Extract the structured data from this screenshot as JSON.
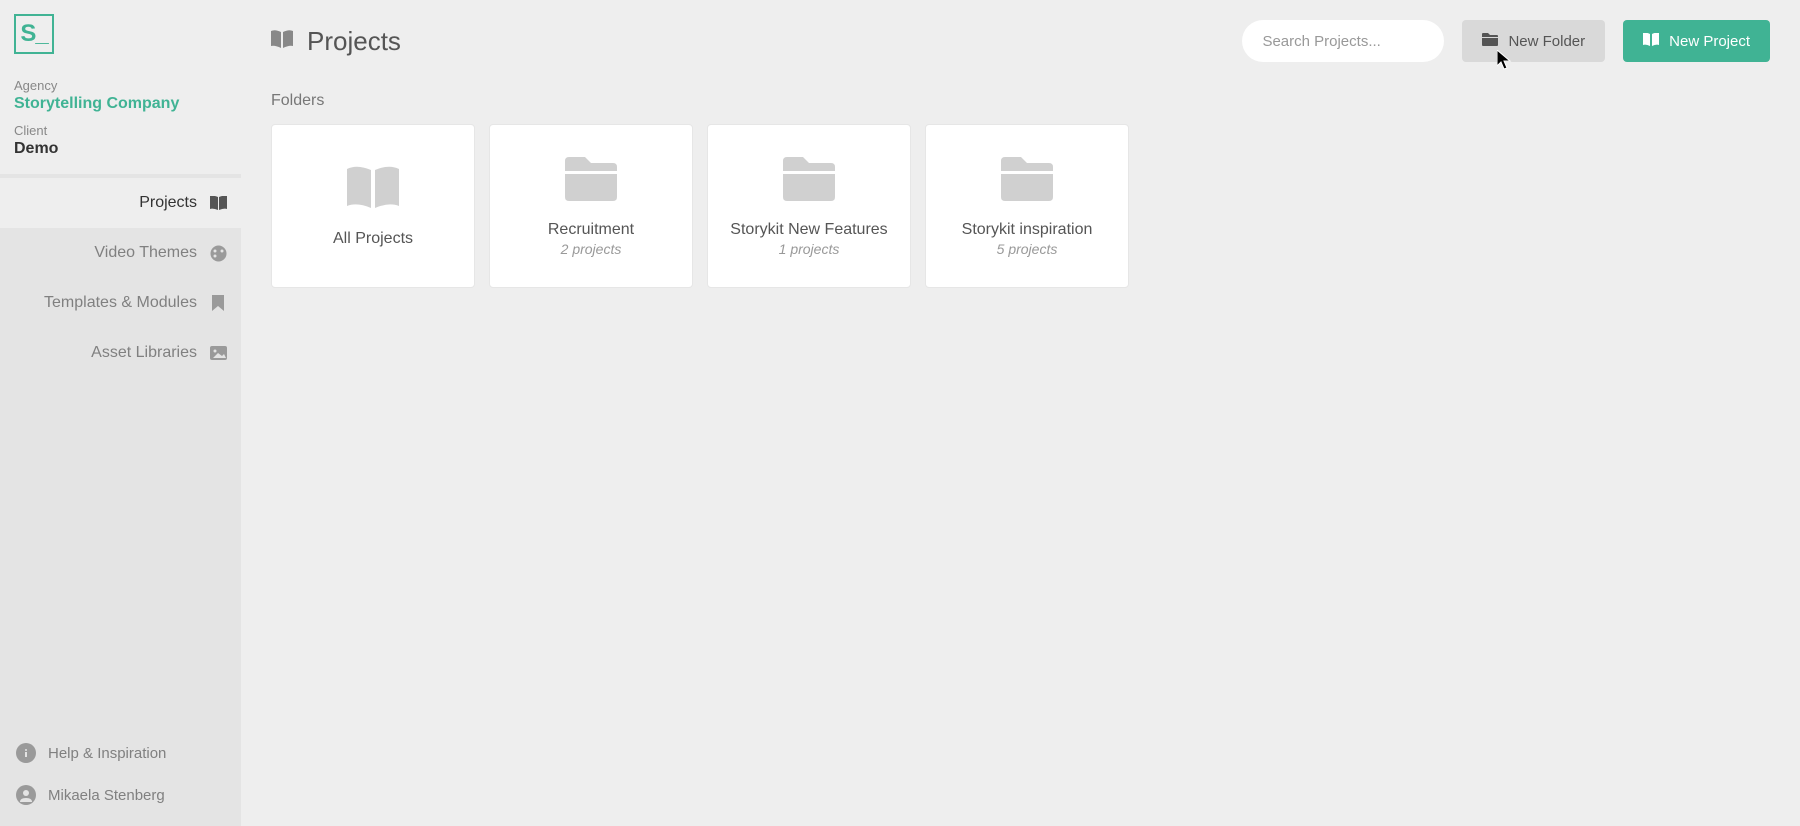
{
  "logo_text": "S_",
  "sidebar": {
    "agency_label": "Agency",
    "agency_name": "Storytelling Company",
    "client_label": "Client",
    "client_name": "Demo",
    "nav": [
      {
        "label": "Projects"
      },
      {
        "label": "Video Themes"
      },
      {
        "label": "Templates & Modules"
      },
      {
        "label": "Asset Libraries"
      }
    ],
    "footer": {
      "help": "Help & Inspiration",
      "user": "Mikaela Stenberg"
    }
  },
  "header": {
    "title": "Projects",
    "search_placeholder": "Search Projects...",
    "new_folder": "New Folder",
    "new_project": "New Project"
  },
  "section_label": "Folders",
  "folders": [
    {
      "title": "All Projects",
      "count": "",
      "type": "all"
    },
    {
      "title": "Recruitment",
      "count": "2 projects",
      "type": "folder"
    },
    {
      "title": "Storykit New Features",
      "count": "1 projects",
      "type": "folder"
    },
    {
      "title": "Storykit inspiration",
      "count": "5 projects",
      "type": "folder"
    }
  ],
  "colors": {
    "accent": "#40b394"
  }
}
